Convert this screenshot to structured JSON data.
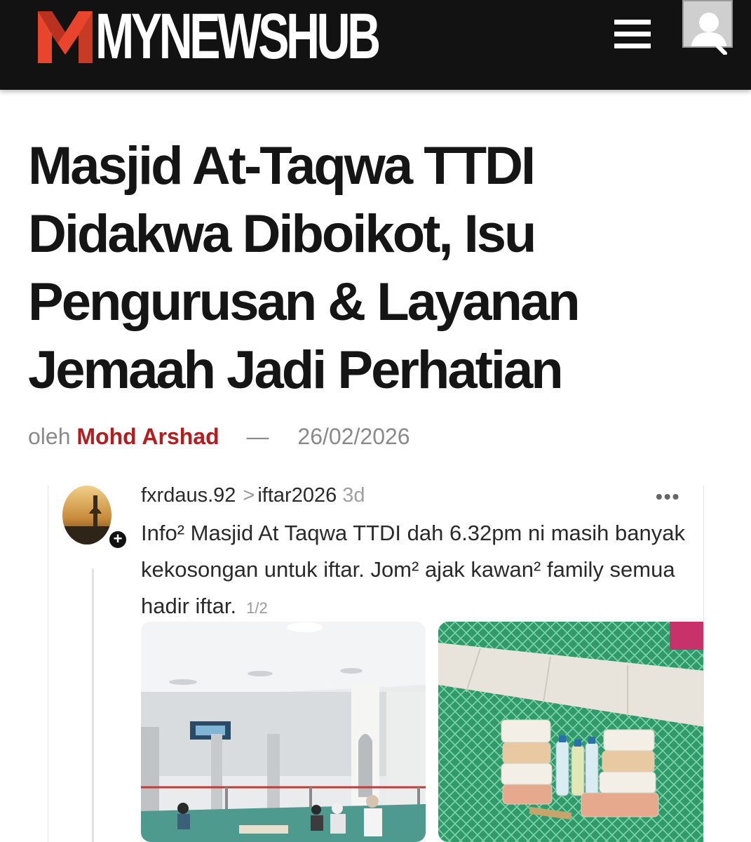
{
  "header": {
    "brand": "MYNEWSHUB",
    "logo_icon": "mynewshub-m-logo",
    "menu_icon": "hamburger-menu-icon",
    "user_icon": "user-avatar-icon",
    "search_icon": "search-icon",
    "accent_color": "#e8452c",
    "background_color": "#121212"
  },
  "article": {
    "title": "Masjid At-Taqwa TTDI Didakwa Diboikot, Isu Pengurusan & Layanan Jemaah Jadi Perhatian",
    "byline_prefix": "oleh",
    "author": "Mohd Arshad",
    "separator": "—",
    "date": "26/02/2026",
    "author_color": "#b21e1e"
  },
  "embedded_post": {
    "username": "fxrdaus.92",
    "chevron": ">",
    "topic": "iftar2026",
    "time_ago": "3d",
    "more_icon": "more-options-icon",
    "follow_badge": "+",
    "text": "Info² Masjid At Taqwa TTDI dah 6.32pm ni masih banyak kekosongan untuk iftar. Jom² ajak kawan² family semua hadir iftar.",
    "page_indicator": "1/2",
    "photos": [
      "mosque-interior-photo",
      "iftar-food-packs-photo"
    ]
  }
}
